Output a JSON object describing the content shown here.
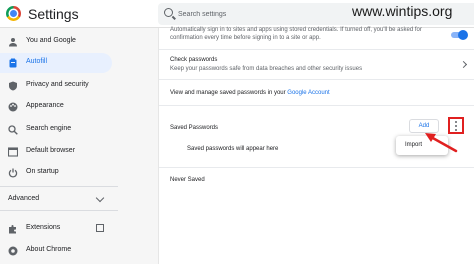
{
  "app": {
    "title": "Settings"
  },
  "search": {
    "placeholder": "Search settings"
  },
  "watermark": "www.wintips.org",
  "sidebar": {
    "items": [
      {
        "label": "You and Google",
        "icon": "person-icon",
        "active": false
      },
      {
        "label": "Autofill",
        "icon": "clipboard-icon",
        "active": true
      },
      {
        "label": "Privacy and security",
        "icon": "shield-icon",
        "active": false
      },
      {
        "label": "Appearance",
        "icon": "palette-icon",
        "active": false
      },
      {
        "label": "Search engine",
        "icon": "search-icon",
        "active": false
      },
      {
        "label": "Default browser",
        "icon": "browser-icon",
        "active": false
      },
      {
        "label": "On startup",
        "icon": "power-icon",
        "active": false
      }
    ],
    "advanced_label": "Advanced",
    "extensions_label": "Extensions",
    "about_label": "About Chrome"
  },
  "main": {
    "autosignin_line1": "Automatically sign in to sites and apps using stored credentials. If turned off, you'll be asked for",
    "autosignin_line2": "confirmation every time before signing in to a site or app.",
    "check_title": "Check passwords",
    "check_desc": "Keep your passwords safe from data breaches and other security issues",
    "manage_text": "View and manage saved passwords in your ",
    "manage_link": "Google Account",
    "saved_passwords_label": "Saved Passwords",
    "add_label": "Add",
    "empty_text": "Saved passwords will appear here",
    "never_saved_label": "Never Saved",
    "menu_import_label": "Import"
  },
  "colors": {
    "accent": "#1a73e8",
    "highlight": "#e02020",
    "active_bg": "#e8f0fe"
  }
}
